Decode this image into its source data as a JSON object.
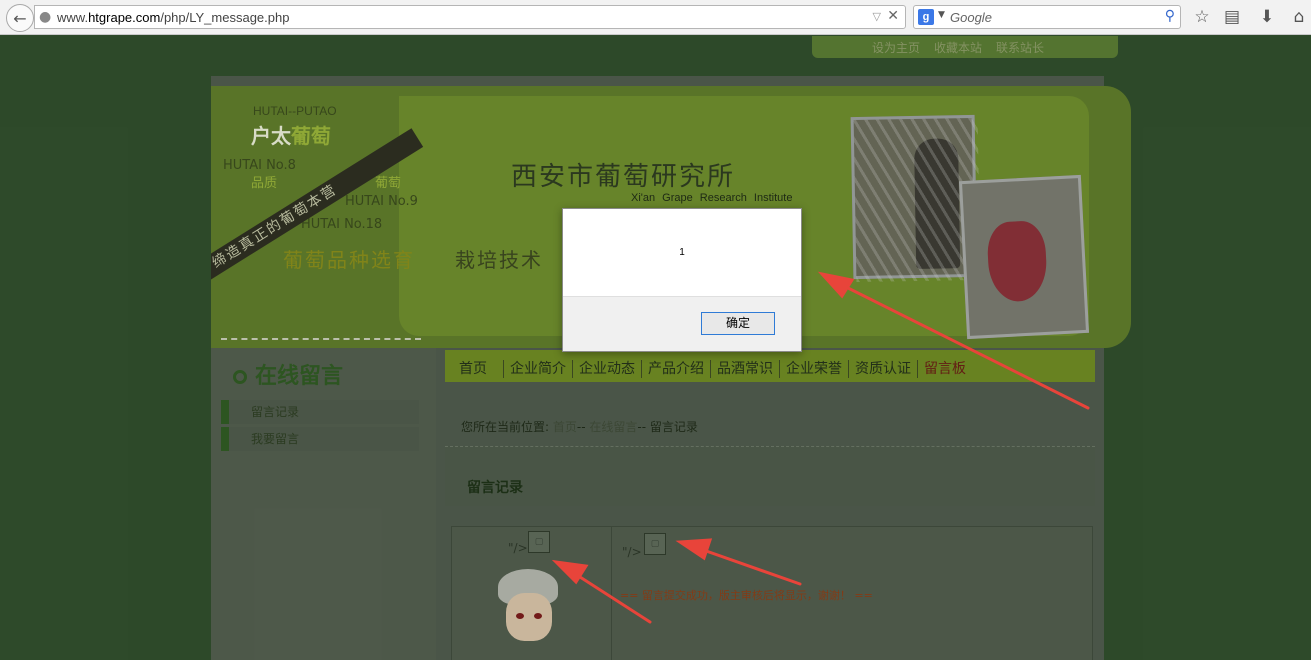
{
  "browser": {
    "url_prefix": "www.",
    "url_host": "htgrape.com",
    "url_path": "/php/LY_message.php",
    "search_engine_glyph": "g",
    "search_placeholder": "Google",
    "icons": [
      "back-arrow-icon",
      "globe-icon",
      "dropdown-icon",
      "stop-icon",
      "search-icon",
      "star-icon",
      "reading-list-icon",
      "download-icon"
    ]
  },
  "toplinks": [
    "设为主页",
    "收藏本站",
    "联系站长"
  ],
  "banner": {
    "brand_en": "HUTAI--PUTAO",
    "brand_cn_a": "户太",
    "brand_cn_b": "葡萄",
    "variety_a": "HUTAI No.8",
    "variety_b": "HUTAI No.9",
    "variety_c": "HUTAI No.18",
    "pinzhong_a": "品质",
    "pinzhong_b": "葡萄",
    "slogan_band": "缔造真正的葡萄本营",
    "site_title": "西安市葡萄研究所",
    "site_subtitle": "Xi'an Grape Research Institute",
    "tagline_a": "葡萄品种选育",
    "tagline_b": "栽培技术"
  },
  "sidebar": {
    "title": "在线留言",
    "items": [
      "留言记录",
      "我要留言"
    ]
  },
  "nav": [
    "首页",
    "企业简介",
    "企业动态",
    "产品介绍",
    "品酒常识",
    "企业荣誉",
    "资质认证",
    "留言板"
  ],
  "breadcrumb": {
    "prefix": "您所在当前位置:",
    "home": "首页",
    "sep1": "--",
    "section": "在线留言",
    "sep2": "--",
    "current": "留言记录"
  },
  "content": {
    "heading": "留言记录",
    "left_fragment": "\"/>",
    "right_fragment": "\"/>",
    "success_message": "== 留言提交成功，版主审核后将显示，谢谢！ =="
  },
  "alert": {
    "message": "1",
    "button_label": "确定"
  },
  "colors": {
    "annotation_arrow": "#e8443a",
    "alert_button_border": "#2f7bd6"
  }
}
